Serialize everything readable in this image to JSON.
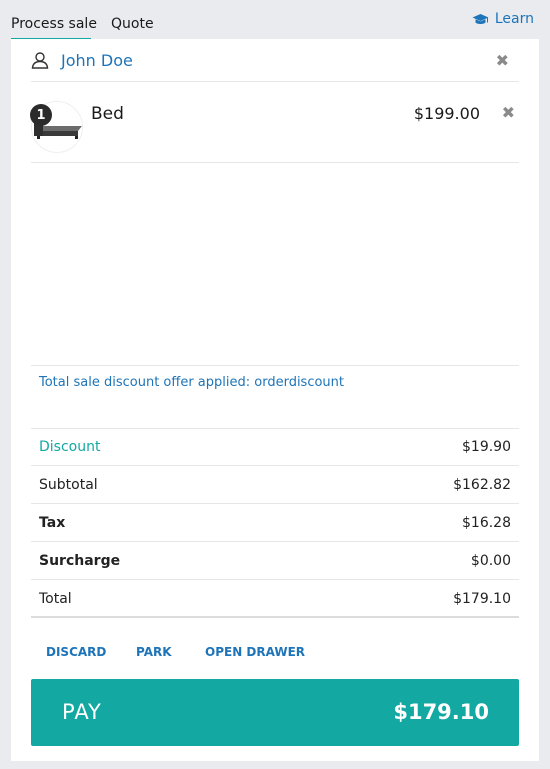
{
  "tabs": [
    {
      "label": "Process sale",
      "active": true
    },
    {
      "label": "Quote",
      "active": false
    }
  ],
  "learn": {
    "label": "Learn",
    "icon": "graduation-cap-icon"
  },
  "customer": {
    "name": "John Doe",
    "icon": "person-icon"
  },
  "line_items": [
    {
      "quantity": "1",
      "name": "Bed",
      "price": "$199.00",
      "thumbnail": "bed-image"
    }
  ],
  "discount_note": "Total sale discount offer applied: orderdiscount",
  "totals": {
    "discount": {
      "label": "Discount",
      "value": "$19.90"
    },
    "subtotal": {
      "label": "Subtotal",
      "value": "$162.82"
    },
    "tax": {
      "label": "Tax",
      "value": "$16.28"
    },
    "surcharge": {
      "label": "Surcharge",
      "value": "$0.00"
    },
    "total": {
      "label": "Total",
      "value": "$179.10"
    }
  },
  "actions": {
    "discard": "DISCARD",
    "park": "PARK",
    "open_drawer": "OPEN DRAWER"
  },
  "pay": {
    "label": "PAY",
    "amount": "$179.10"
  },
  "colors": {
    "accent": "#13a8a2",
    "link": "#1e74b8",
    "background": "#e9ebef"
  }
}
